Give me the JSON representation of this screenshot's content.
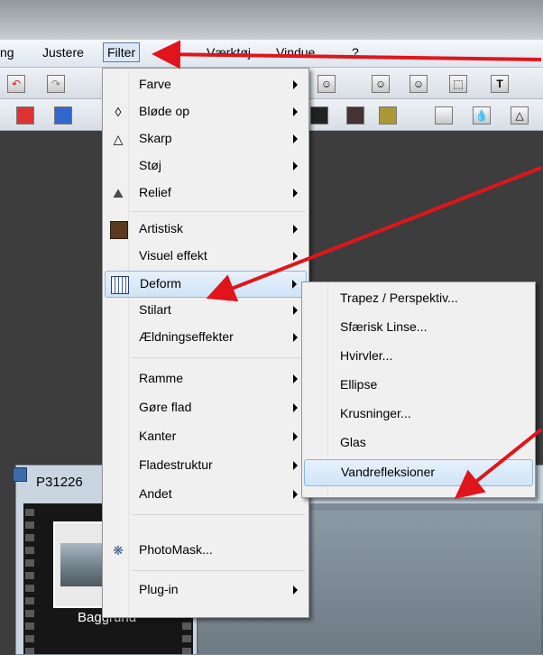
{
  "menubar": {
    "items": [
      "ng",
      "Justere",
      "Filter",
      "s",
      "Værktøj",
      "Vindue",
      "?"
    ],
    "selected": "Filter"
  },
  "filter_menu": {
    "items": [
      {
        "label": "Farve",
        "icon": "",
        "submenu": true
      },
      {
        "label": "Bløde op",
        "icon": "drop-icon",
        "submenu": true
      },
      {
        "label": "Skarp",
        "icon": "triangle-icon",
        "submenu": true
      },
      {
        "label": "Støj",
        "icon": "",
        "submenu": true
      },
      {
        "label": "Relief",
        "icon": "relief-icon",
        "submenu": true
      },
      {
        "label": "Artistisk",
        "icon": "mona-lisa-icon",
        "submenu": true
      },
      {
        "label": "Visuel effekt",
        "icon": "",
        "submenu": true
      },
      {
        "label": "Deform",
        "icon": "grid-icon",
        "submenu": true,
        "highlighted": true
      },
      {
        "label": "Stilart",
        "icon": "",
        "submenu": true
      },
      {
        "label": "Ældningseffekter",
        "icon": "",
        "submenu": true
      },
      {
        "label": "Ramme",
        "icon": "",
        "submenu": true
      },
      {
        "label": "Gøre flad",
        "icon": "",
        "submenu": true
      },
      {
        "label": "Kanter",
        "icon": "",
        "submenu": true
      },
      {
        "label": "Fladestruktur",
        "icon": "",
        "submenu": true
      },
      {
        "label": "Andet",
        "icon": "",
        "submenu": true
      },
      {
        "label": "PhotoMask...",
        "icon": "photomask-icon",
        "submenu": false
      },
      {
        "label": "Plug-in",
        "icon": "",
        "submenu": true
      }
    ]
  },
  "deform_submenu": {
    "items": [
      {
        "label": "Trapez / Perspektiv..."
      },
      {
        "label": "Sfærisk Linse..."
      },
      {
        "label": "Hvirvler..."
      },
      {
        "label": "Ellipse"
      },
      {
        "label": "Krusninger..."
      },
      {
        "label": "Glas"
      },
      {
        "label": "Vandrefleksioner",
        "highlighted": true
      }
    ]
  },
  "document": {
    "title": "P31226",
    "layer_label": "Baggrund"
  },
  "annotation": {
    "arrow_color": "#e0151b"
  }
}
